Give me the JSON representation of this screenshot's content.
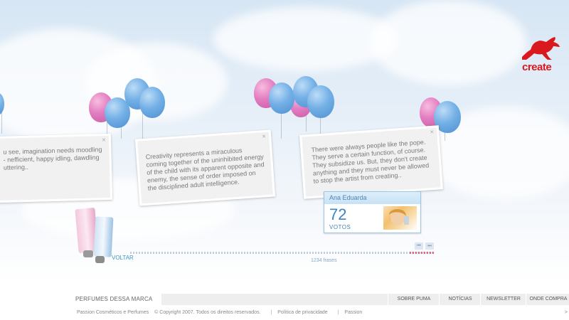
{
  "brand": {
    "name": "puma-cat-logo",
    "tagline": "create",
    "color": "#d9191d"
  },
  "cards": [
    {
      "text": "u see, imagination needs moodling - nefficient, happy idling, dawdling uttering.."
    },
    {
      "text": "Creativity represents a miraculous coming together of the uninhibited energy of the child with its apparent opposite and enemy, the sense of order imposed on the disciplined adult intelligence."
    },
    {
      "text": "There were always people like the pope. They serve a certain function, of course. They subsidize us. But, they don't create anything and they must never be allowed to stop the artist from creating.."
    }
  ],
  "vote": {
    "author": "Ana Eduarda",
    "count": "72",
    "label": "VOTOS"
  },
  "timeline": {
    "frases": "1234 frases",
    "prev": "⏮",
    "next": "⏭"
  },
  "voltar": "VOLTAR",
  "footer": {
    "left_title": "PERFUMES DESSA MARCA",
    "nav": [
      "SOBRE PUMA",
      "NOTÍCIAS",
      "NEWSLETTER",
      "ONDE COMPRA"
    ],
    "company": "Passion Cosméticos e Perfumes",
    "copyright": "© Copyright 2007. Todos os direitos reservados.",
    "privacy": "Política de privacidade",
    "passion": "Passion",
    "corner": ">"
  },
  "colors": {
    "accent_blue": "#3d84c0",
    "balloon_blue": "#74b0e6",
    "balloon_pink": "#e37ec1"
  }
}
